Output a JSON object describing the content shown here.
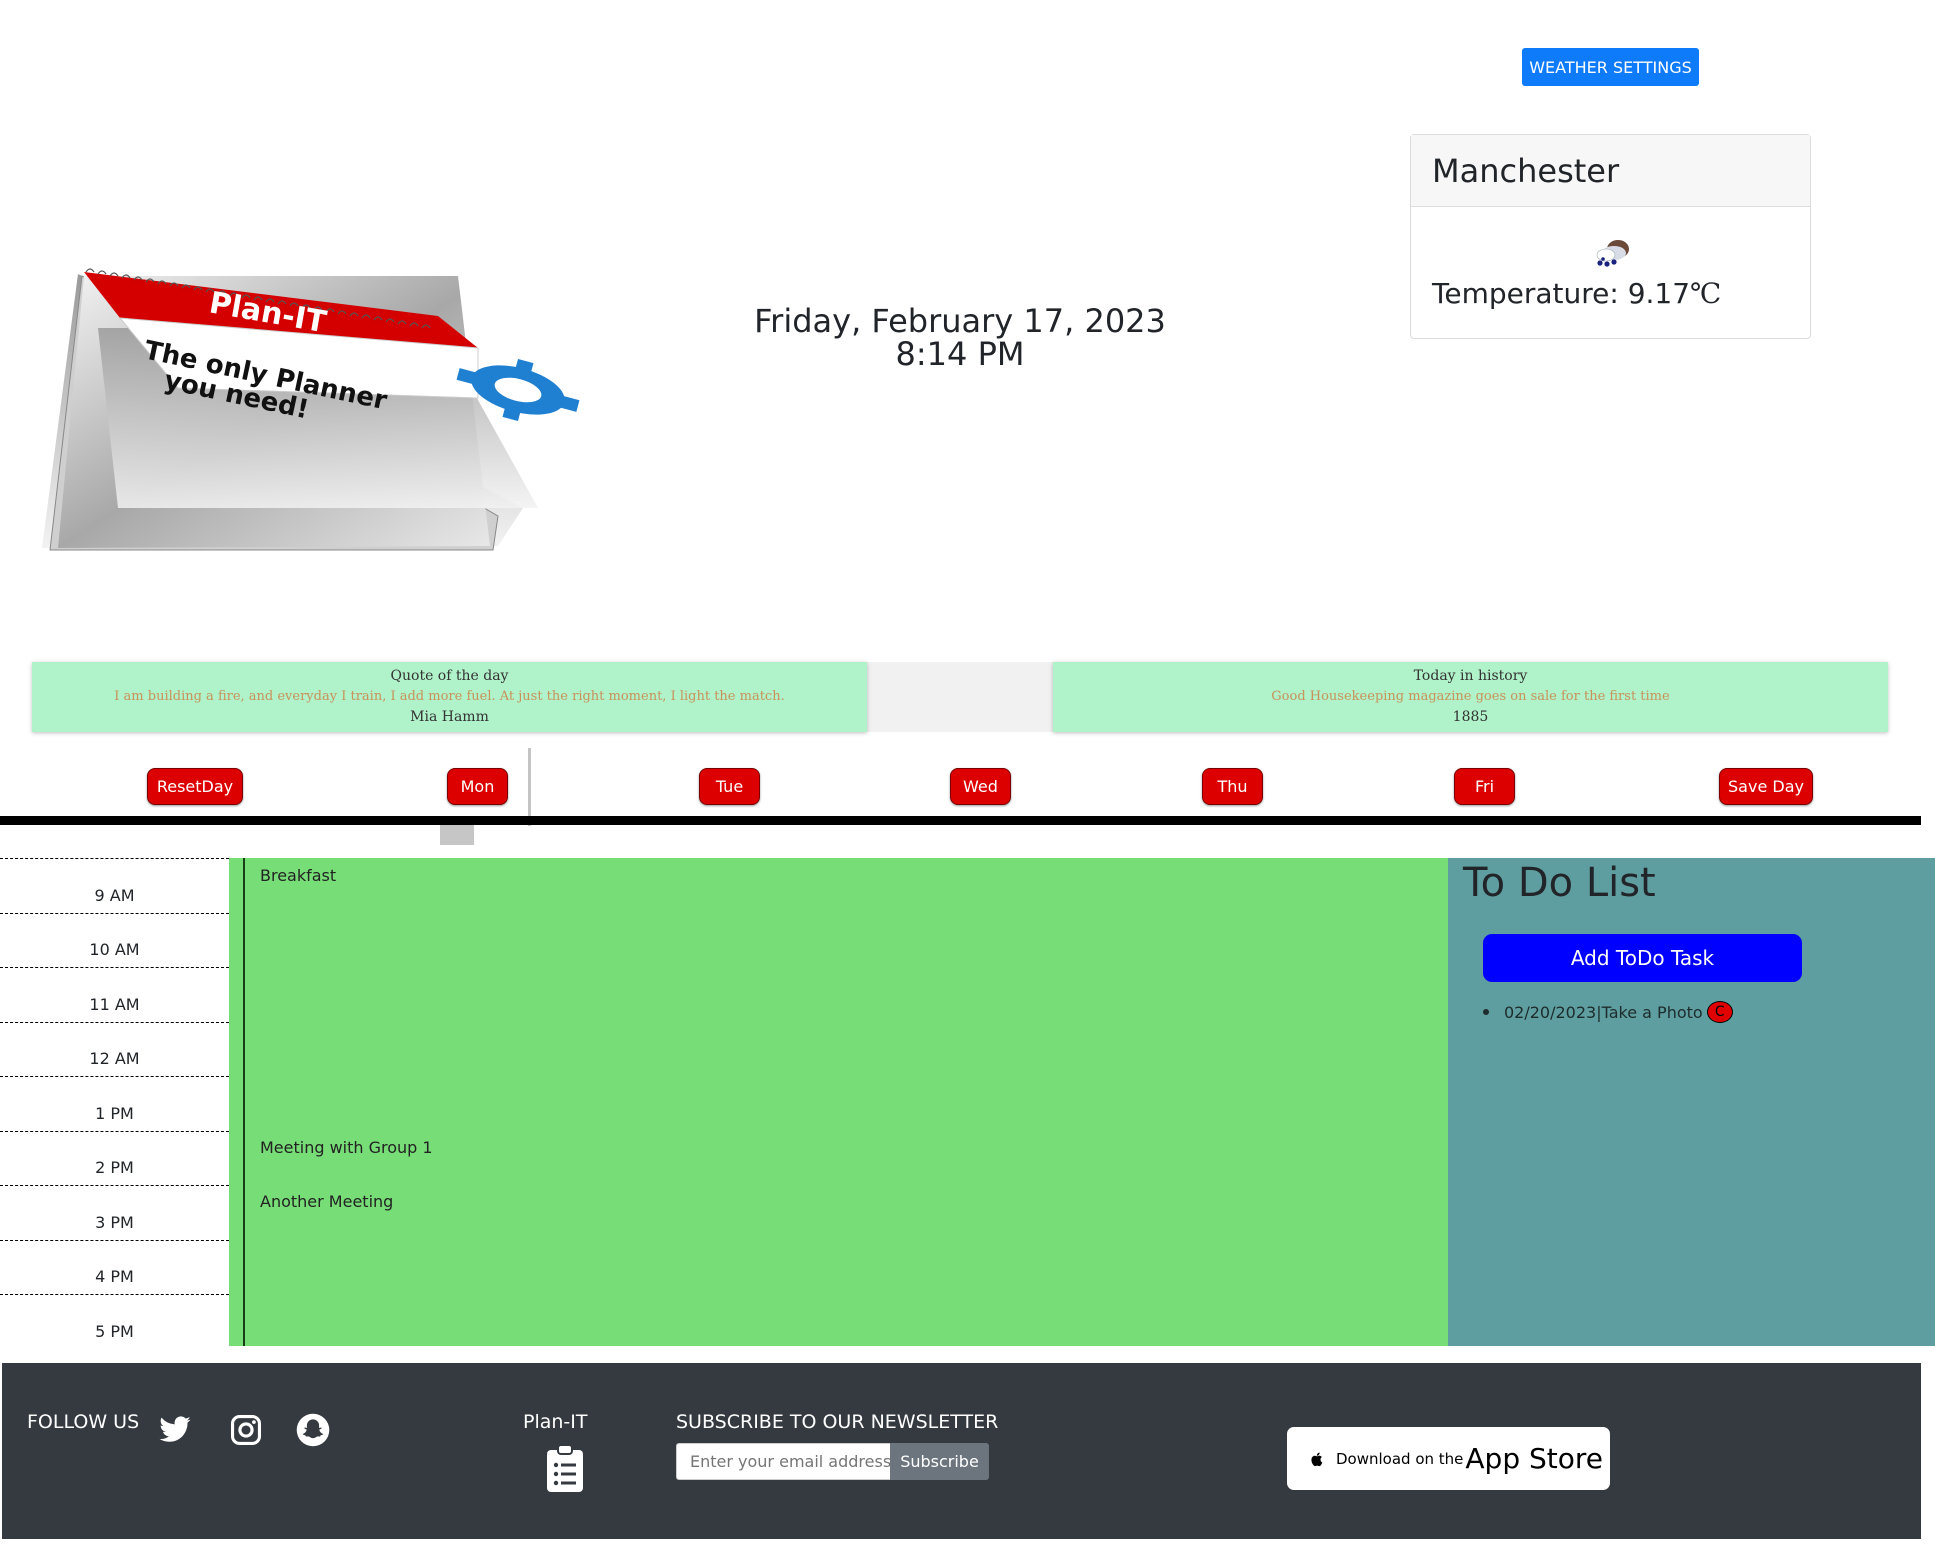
{
  "header": {
    "weather_settings_label": "WEATHER SETTINGS",
    "datetime": "Friday, February 17, 2023 8:14 PM"
  },
  "weather": {
    "city": "Manchester",
    "temperature_label": "Temperature: 9.17",
    "unit": "℃",
    "icon": "rain-cloud-icon"
  },
  "logo": {
    "banner_text": "Plan-IT",
    "tagline_line1": "The only Planner",
    "tagline_line2": "you need!"
  },
  "quote": {
    "title": "Quote of the day",
    "text": "I am building a fire, and everyday I train, I add more fuel. At just the right moment, I light the match.",
    "author": "Mia Hamm"
  },
  "history": {
    "title": "Today in history",
    "text": "Good Housekeeping magazine goes on sale for the first time",
    "year": "1885"
  },
  "days": {
    "reset": "ResetDay",
    "mon": "Mon",
    "tue": "Tue",
    "wed": "Wed",
    "thu": "Thu",
    "fri": "Fri",
    "save": "Save Day"
  },
  "hours": [
    "9 AM",
    "10 AM",
    "11 AM",
    "12 AM",
    "1 PM",
    "2 PM",
    "3 PM",
    "4 PM",
    "5 PM"
  ],
  "events": {
    "breakfast": "Breakfast",
    "meeting1": "Meeting with Group 1",
    "meeting2": "Another Meeting"
  },
  "todo": {
    "title": "To Do List",
    "add_label": "Add ToDo Task",
    "items": [
      {
        "text": "02/20/2023|Take a Photo",
        "delete_label": "C"
      }
    ]
  },
  "footer": {
    "follow": "FOLLOW US",
    "social": [
      "twitter-icon",
      "instagram-icon",
      "snapchat-icon"
    ],
    "brand": "Plan-IT",
    "newsletter_title": "SUBSCRIBE TO OUR NEWSLETTER",
    "email_placeholder": "Enter your email address",
    "subscribe_label": "Subscribe",
    "appstore_small": "Download on the",
    "appstore_big": "App Store"
  },
  "colors": {
    "accent_blue": "#0d7bfa",
    "day_button_red": "#dd0000",
    "planner_green": "#77dd77",
    "todo_teal": "#5f9ea0",
    "quote_green": "#b0f2c9",
    "footer_dark": "#343a40"
  }
}
